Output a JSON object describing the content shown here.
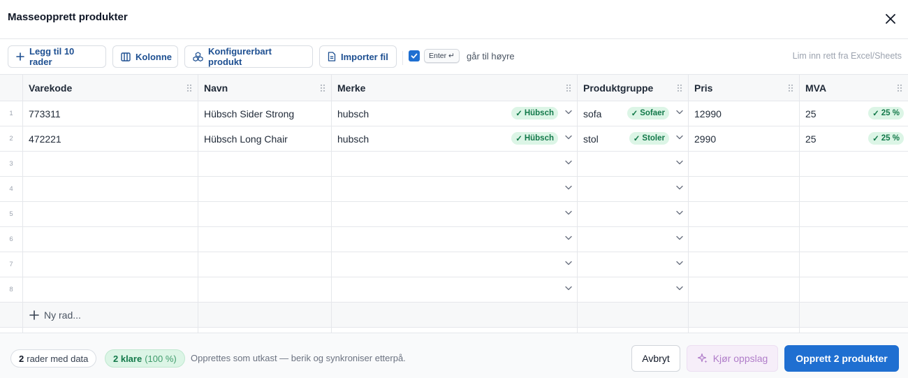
{
  "dialog": {
    "title": "Masseopprett produkter"
  },
  "toolbar": {
    "add_rows_label": "Legg til 10 rader",
    "column_label": "Kolonne",
    "configurable_label": "Konfigurerbart produkt",
    "import_label": "Importer fil",
    "enter_checked": true,
    "enter_key": "Enter ↵",
    "enter_hint": "går til høyre",
    "paste_hint": "Lim inn rett fra Excel/Sheets"
  },
  "table": {
    "columns": [
      "Varekode",
      "Navn",
      "Merke",
      "Produktgruppe",
      "Pris",
      "MVA"
    ],
    "row_numbers": [
      "1",
      "2",
      "3",
      "4",
      "5",
      "6",
      "7",
      "8"
    ],
    "rows": [
      {
        "varekode": "773311",
        "navn": "Hübsch Sider Strong",
        "merke": "hubsch",
        "merke_badge": "Hübsch",
        "gruppe": "sofa",
        "gruppe_badge": "Sofaer",
        "pris": "12990",
        "mva": "25",
        "mva_badge": "25 %"
      },
      {
        "varekode": "472221",
        "navn": "Hübsch Long Chair",
        "merke": "hubsch",
        "merke_badge": "Hübsch",
        "gruppe": "stol",
        "gruppe_badge": "Stoler",
        "pris": "2990",
        "mva": "25",
        "mva_badge": "25 %"
      }
    ],
    "new_row_label": "Ny rad..."
  },
  "footer": {
    "rows_count": "2",
    "rows_label": "rader med data",
    "ready_count": "2 klare",
    "ready_pct": "(100 %)",
    "hint": "Opprettes som utkast — berik og synkroniser etterpå.",
    "cancel_label": "Avbryt",
    "lookup_label": "Kjør oppslag",
    "create_label": "Opprett 2 produkter"
  },
  "colors": {
    "primary": "#1f6fd1",
    "success_bg": "#dcf5e6",
    "success_text": "#13794a",
    "lookup_text": "#b07dc9"
  }
}
